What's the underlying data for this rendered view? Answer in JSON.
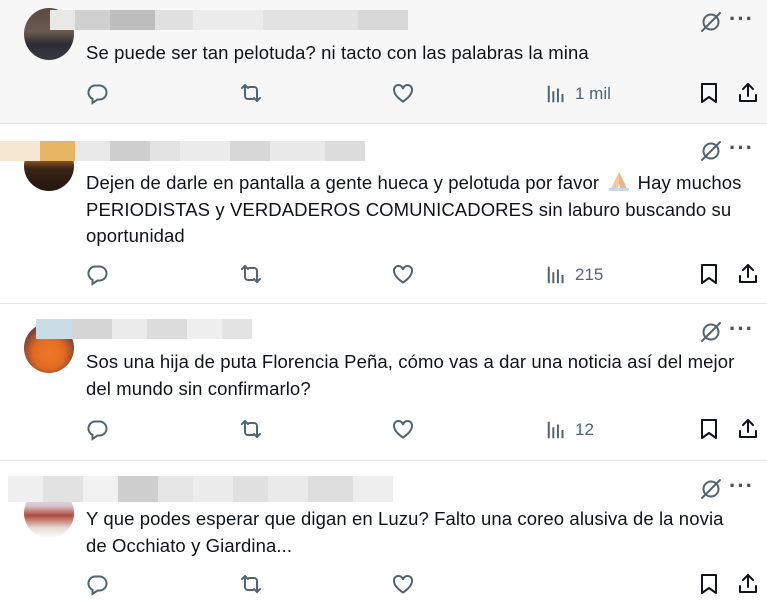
{
  "posts": [
    {
      "text": "Se puede ser tan pelotuda? ni tacto con las palabras la mina",
      "views": "1 mil"
    },
    {
      "text": "Dejen de darle en pantalla a gente hueca y pelotuda por favor",
      "text_tail": " Hay muchos PERIODISTAS y VERDADEROS COMUNICADORES sin laburo buscando su oportunidad",
      "views": "215"
    },
    {
      "text": "Sos una hija de puta Florencia Peña, cómo vas a dar una noticia así del mejor del mundo sin confirmarlo?",
      "views": "12"
    },
    {
      "text": "Y que podes esperar que digan en Luzu? Falto una coreo alusiva de la novia de Occhiato y Giardina..."
    }
  ],
  "icons": {
    "grok": "grok-icon",
    "more": "more-icon",
    "reply": "reply-icon",
    "repost": "repost-icon",
    "like": "like-icon",
    "views": "views-icon",
    "bookmark": "bookmark-icon",
    "share": "share-icon",
    "emoji": "praying-hands-emoji"
  },
  "colors": {
    "icon": "#536471",
    "text": "#0f1419",
    "divider": "#e4e6e9"
  },
  "more_label": "···"
}
